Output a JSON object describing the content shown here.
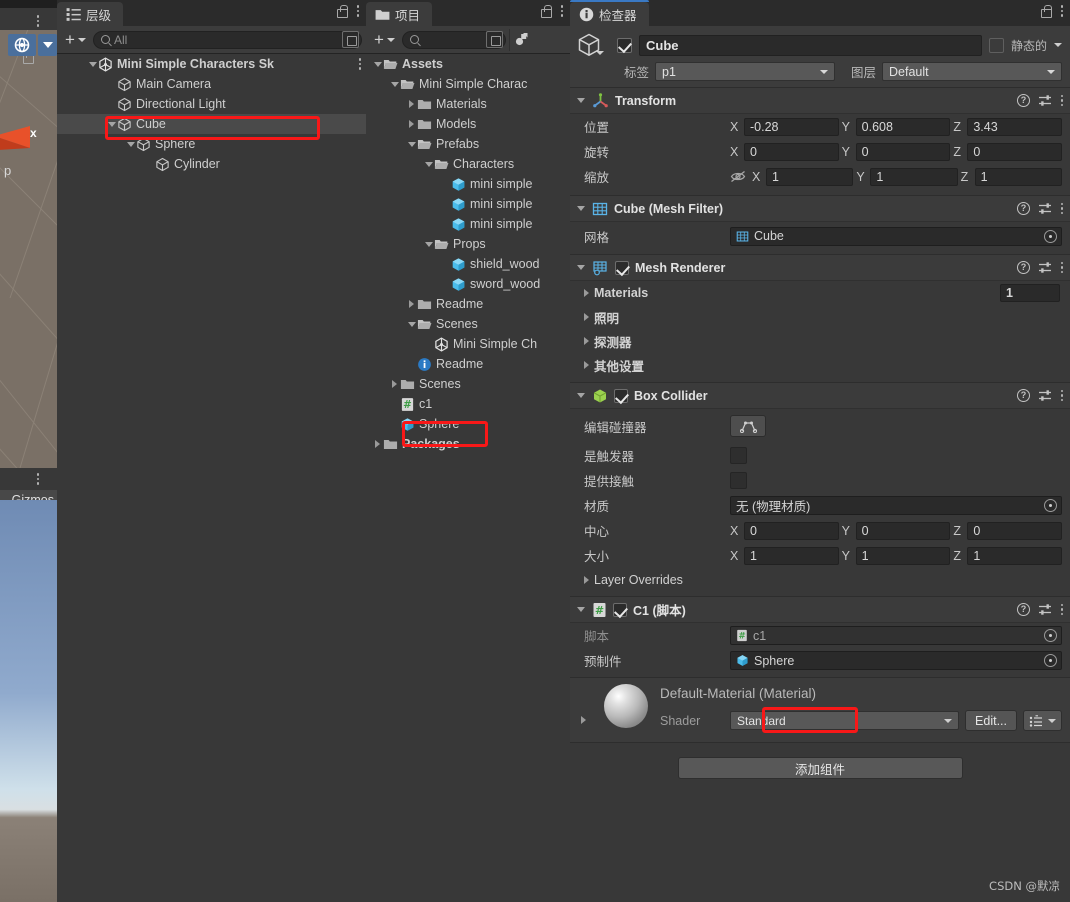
{
  "app": "Unity Editor",
  "scene_view": {
    "gizmo_label_x": "x",
    "gizmo_label_p": "p",
    "lock_icon": "lock-icon",
    "menu_icon": "kebab-icon"
  },
  "game_view": {
    "gizmos_label": "Gizmos"
  },
  "hierarchy": {
    "tab_label": "层级",
    "tab_icon": "hierarchy-icon",
    "toolbar": {
      "add_label": "+",
      "search_placeholder": "All",
      "search_value": "",
      "search_icon": "search-icon",
      "expand_icon": "expand-window-icon"
    },
    "items": [
      {
        "label": "Mini Simple Characters Sk",
        "depth": 0,
        "arrow": "down",
        "icon": "unity-scene-icon",
        "bold": true,
        "selected": false,
        "has_kebab": true
      },
      {
        "label": "Main Camera",
        "depth": 1,
        "arrow": "none",
        "icon": "gameobject-icon",
        "bold": false,
        "selected": false
      },
      {
        "label": "Directional Light",
        "depth": 1,
        "arrow": "none",
        "icon": "gameobject-icon",
        "bold": false,
        "selected": false
      },
      {
        "label": "Cube",
        "depth": 1,
        "arrow": "down",
        "icon": "gameobject-icon",
        "bold": false,
        "selected": true
      },
      {
        "label": "Sphere",
        "depth": 2,
        "arrow": "down",
        "icon": "gameobject-icon",
        "bold": false,
        "selected": false
      },
      {
        "label": "Cylinder",
        "depth": 3,
        "arrow": "none",
        "icon": "gameobject-icon",
        "bold": false,
        "selected": false
      }
    ]
  },
  "project": {
    "tab_label": "项目",
    "tab_icon": "folder-icon",
    "toolbar": {
      "add_label": "+",
      "search_placeholder": "",
      "search_value": "",
      "search_icon": "search-icon",
      "expand_icon": "expand-window-icon",
      "filter_icon": "object-filter-icon"
    },
    "items": [
      {
        "label": "Assets",
        "depth": 0,
        "arrow": "down",
        "icon": "folder-open-icon",
        "bold": true
      },
      {
        "label": "Mini Simple Charac",
        "depth": 1,
        "arrow": "down",
        "icon": "folder-open-icon",
        "bold": false
      },
      {
        "label": "Materials",
        "depth": 2,
        "arrow": "right",
        "icon": "folder-icon",
        "bold": false
      },
      {
        "label": "Models",
        "depth": 2,
        "arrow": "right",
        "icon": "folder-icon",
        "bold": false
      },
      {
        "label": "Prefabs",
        "depth": 2,
        "arrow": "down",
        "icon": "folder-open-icon",
        "bold": false
      },
      {
        "label": "Characters",
        "depth": 3,
        "arrow": "down",
        "icon": "folder-open-icon",
        "bold": false
      },
      {
        "label": "mini simple",
        "depth": 4,
        "arrow": "none",
        "icon": "prefab-icon",
        "bold": false
      },
      {
        "label": "mini simple",
        "depth": 4,
        "arrow": "none",
        "icon": "prefab-icon",
        "bold": false
      },
      {
        "label": "mini simple",
        "depth": 4,
        "arrow": "none",
        "icon": "prefab-icon",
        "bold": false
      },
      {
        "label": "Props",
        "depth": 3,
        "arrow": "down",
        "icon": "folder-open-icon",
        "bold": false
      },
      {
        "label": "shield_wood",
        "depth": 4,
        "arrow": "none",
        "icon": "prefab-icon",
        "bold": false
      },
      {
        "label": "sword_wood",
        "depth": 4,
        "arrow": "none",
        "icon": "prefab-icon",
        "bold": false
      },
      {
        "label": "Readme",
        "depth": 2,
        "arrow": "right",
        "icon": "folder-icon",
        "bold": false
      },
      {
        "label": "Scenes",
        "depth": 2,
        "arrow": "down",
        "icon": "folder-open-icon",
        "bold": false
      },
      {
        "label": "Mini Simple Ch",
        "depth": 3,
        "arrow": "none",
        "icon": "unity-scene-icon",
        "bold": false
      },
      {
        "label": "Readme",
        "depth": 2,
        "arrow": "none",
        "icon": "info-icon",
        "bold": false
      },
      {
        "label": "Scenes",
        "depth": 1,
        "arrow": "right",
        "icon": "folder-icon",
        "bold": false
      },
      {
        "label": "c1",
        "depth": 1,
        "arrow": "none",
        "icon": "script-icon",
        "bold": false
      },
      {
        "label": "Sphere",
        "depth": 1,
        "arrow": "none",
        "icon": "prefab-icon",
        "bold": false
      },
      {
        "label": "Packages",
        "depth": 0,
        "arrow": "right",
        "icon": "folder-icon",
        "bold": true
      }
    ]
  },
  "inspector": {
    "tab_label": "检查器",
    "tab_icon": "info-icon",
    "object": {
      "icon": "gameobject-icon",
      "enabled": true,
      "name": "Cube",
      "static_checked": false,
      "static_label": "静态的",
      "tag_label": "标签",
      "tag_value": "p1",
      "layer_label": "图层",
      "layer_value": "Default"
    },
    "components": [
      {
        "id": "transform",
        "title": "Transform",
        "icon": "transform-icon",
        "has_checkbox": false,
        "rows": [
          {
            "label": "位置",
            "axes": [
              "X",
              "Y",
              "Z"
            ],
            "values": [
              "-0.28",
              "0.608",
              "3.43"
            ]
          },
          {
            "label": "旋转",
            "axes": [
              "X",
              "Y",
              "Z"
            ],
            "values": [
              "0",
              "0",
              "0"
            ]
          },
          {
            "label": "缩放",
            "axes": [
              "X",
              "Y",
              "Z"
            ],
            "values": [
              "1",
              "1",
              "1"
            ],
            "link_icon": "scale-unlink-icon"
          }
        ]
      },
      {
        "id": "mesh-filter",
        "title": "Cube (Mesh Filter)",
        "icon": "mesh-filter-icon",
        "has_checkbox": false,
        "mesh_label": "网格",
        "mesh_value": "Cube"
      },
      {
        "id": "mesh-renderer",
        "title": "Mesh Renderer",
        "icon": "mesh-renderer-icon",
        "has_checkbox": true,
        "checked": true,
        "folds": [
          {
            "label": "Materials",
            "count": "1"
          },
          {
            "label": "照明"
          },
          {
            "label": "探测器"
          },
          {
            "label": "其他设置"
          }
        ]
      },
      {
        "id": "box-collider",
        "title": "Box Collider",
        "icon": "box-collider-icon",
        "has_checkbox": true,
        "checked": true,
        "edit_label": "编辑碰撞器",
        "edit_icon": "edit-collider-icon",
        "is_trigger_label": "是触发器",
        "is_trigger_checked": false,
        "provides_contacts_label": "提供接触",
        "provides_contacts_checked": false,
        "material_label": "材质",
        "material_value": "无 (物理材质)",
        "center_label": "中心",
        "center_values": [
          "0",
          "0",
          "0"
        ],
        "size_label": "大小",
        "size_values": [
          "1",
          "1",
          "1"
        ],
        "layer_overrides_label": "Layer Overrides"
      },
      {
        "id": "c1-script",
        "title": "C1  (脚本)",
        "icon": "script-icon",
        "has_checkbox": true,
        "checked": true,
        "script_label": "脚本",
        "script_value": "c1",
        "prefab_label": "预制件",
        "prefab_value": "Sphere"
      }
    ],
    "material_preview": {
      "name": "Default-Material (Material)",
      "shader_label": "Shader",
      "shader_value": "Standard",
      "edit_label": "Edit...",
      "preset_icon": "preset-list-icon"
    },
    "add_component_label": "添加组件"
  },
  "watermark": "CSDN @默凉",
  "colors": {
    "panel_bg": "#383838",
    "header_bg": "#3c3c3c",
    "tabbar_bg": "#2b2b2b",
    "field_bg": "#2a2a2a",
    "selection": "#4a4a4a",
    "accent_blue": "#3a79c4",
    "annotation_red": "#f81818",
    "prefab_blue": "#4bbcea",
    "script_green": "#4caf50",
    "collider_green": "#a0d468"
  }
}
